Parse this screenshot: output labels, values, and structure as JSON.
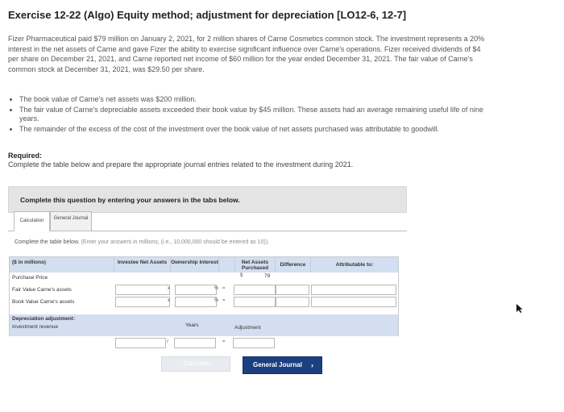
{
  "title": "Exercise 12-22 (Algo) Equity method; adjustment for depreciation [LO12-6, 12-7]",
  "problem": {
    "paragraph": "Fizer Pharmaceutical paid $79 million on January 2, 2021, for 2 million shares of Carne Cosmetics common stock. The investment represents a 20% interest in the net assets of Carne and gave Fizer the ability to exercise significant influence over Carne's operations. Fizer received dividends of $4 per share on December 21, 2021, and Carne reported net income of $60 million for the year ended December 31, 2021. The fair value of Carne's common stock at December 31, 2021, was $29.50 per share.",
    "bullets": [
      "The book value of Carne's net assets was $200 million.",
      "The fair value of Carne's depreciable assets exceeded their book value by $45 million. These assets had an average remaining useful life of nine years.",
      "The remainder of the excess of the cost of the investment over the book value of net assets purchased was attributable to goodwill."
    ],
    "required_label": "Required:",
    "required_text": "Complete the table below and prepare the appropriate journal entries related to the investment during 2021."
  },
  "instructions": "Complete this question by entering your answers in the tabs below.",
  "tabs": [
    {
      "label": "Calculation",
      "active": true
    },
    {
      "label": "General Journal",
      "active": false
    }
  ],
  "table_instructions": "Complete the table below.",
  "table_instructions_paren": "(Enter your answers in millions, (i.e., 10,000,000 should be entered as 10)).",
  "table": {
    "headers": {
      "label": "($ in millions)",
      "investee_net_assets": "Investee Net Assets",
      "ownership_interest": "Ownership Interest",
      "net_assets_purchased": "Net Assets Purchased",
      "difference": "Difference",
      "attributable_to": "Attributable to:"
    },
    "rows": [
      {
        "label": "Purchase Price",
        "currency": "$",
        "net_assets_purchased": "79"
      },
      {
        "label": "Fair Value Carne's assets",
        "op1": "x",
        "op2": "%",
        "op3": "="
      },
      {
        "label": "Book Value Carne's assets",
        "op1": "x",
        "op2": "%",
        "op3": "="
      }
    ],
    "depreciation": {
      "label": "Depreciation adjustment:",
      "sub_label": "Investment revenue",
      "years_label": "Years",
      "adjustment_label": "Adjustment",
      "div_op": "/",
      "eq_op": "="
    }
  },
  "nav": {
    "prev_label": "Calculation",
    "next_label": "General Journal"
  },
  "colors": {
    "header_blue": "#d3dff0",
    "next_button": "#1c3f80",
    "instructions_bar": "#e4e4e4"
  }
}
